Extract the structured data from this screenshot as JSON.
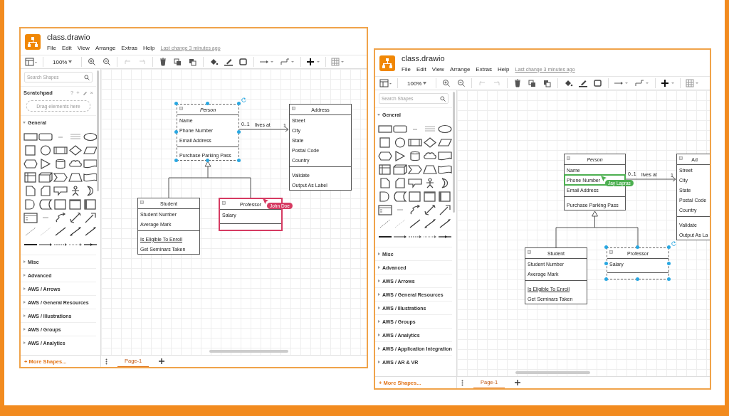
{
  "windows": [
    {
      "title": "class.drawio",
      "menu": [
        "File",
        "Edit",
        "View",
        "Arrange",
        "Extras",
        "Help"
      ],
      "last_change": "Last change 3 minutes ago",
      "toolbar": {
        "zoom": "100%",
        "undo": {
          "disabled": true
        },
        "redo": {
          "disabled": true
        }
      },
      "sidebar": {
        "search": {
          "placeholder": "Search Shapes"
        },
        "scratchpad": {
          "title": "Scratchpad",
          "tools": [
            "?",
            "+",
            "×"
          ],
          "hint": "Drag elements here"
        },
        "sections": [
          {
            "label": "General",
            "expanded": true
          },
          {
            "label": "Misc",
            "expanded": false
          },
          {
            "label": "Advanced",
            "expanded": false
          },
          {
            "label": "AWS / Arrows",
            "expanded": false
          },
          {
            "label": "AWS / General Resources",
            "expanded": false
          },
          {
            "label": "AWS / Illustrations",
            "expanded": false
          },
          {
            "label": "AWS / Groups",
            "expanded": false
          },
          {
            "label": "AWS / Analytics",
            "expanded": false
          }
        ],
        "more_shapes": "+ More Shapes..."
      },
      "diagram": {
        "classes": [
          {
            "name": "Person",
            "abstract": true,
            "selected": true,
            "attributes": [
              {
                "text": "Name"
              },
              {
                "text": "Phone Number"
              },
              {
                "text": "Email Address"
              }
            ],
            "methods": [
              {
                "text": "Purchase Parking Pass",
                "static": false
              }
            ]
          },
          {
            "name": "Address",
            "abstract": false,
            "selected": false,
            "attributes": [
              {
                "text": "Street"
              },
              {
                "text": "City"
              },
              {
                "text": "State"
              },
              {
                "text": "Postal Code"
              },
              {
                "text": "Country"
              }
            ],
            "methods": [
              {
                "text": "Validate",
                "static": false
              },
              {
                "text": "Output As Label",
                "static": false
              }
            ]
          },
          {
            "name": "Student",
            "abstract": false,
            "selected": false,
            "attributes": [
              {
                "text": "Student Number"
              },
              {
                "text": "Average Mark"
              }
            ],
            "methods": [
              {
                "text": "Is Eligible To Enroll",
                "static": true
              },
              {
                "text": "Get Seminars Taken",
                "static": false
              }
            ]
          },
          {
            "name": "Professor",
            "abstract": false,
            "selected": false,
            "attributes": [
              {
                "text": "Salary"
              }
            ],
            "collaborator": {
              "name": "John Doe",
              "color": "#d63b62"
            }
          }
        ],
        "association": {
          "label": "lives at",
          "source_multiplicity": "0..1",
          "target_multiplicity": "1"
        }
      },
      "pages": [
        {
          "label": "Page-1",
          "selected": true
        }
      ]
    },
    {
      "title": "class.drawio",
      "menu": [
        "File",
        "Edit",
        "View",
        "Arrange",
        "Extras",
        "Help"
      ],
      "last_change": "Last change 3 minutes ago",
      "toolbar": {
        "zoom": "100%",
        "undo": {
          "disabled": true
        },
        "redo": {
          "disabled": true
        }
      },
      "sidebar": {
        "search": {
          "placeholder": "Search Shapes"
        },
        "sections": [
          {
            "label": "General",
            "expanded": true
          },
          {
            "label": "Misc",
            "expanded": false
          },
          {
            "label": "Advanced",
            "expanded": false
          },
          {
            "label": "AWS / Arrows",
            "expanded": false
          },
          {
            "label": "AWS / General Resources",
            "expanded": false
          },
          {
            "label": "AWS / Illustrations",
            "expanded": false
          },
          {
            "label": "AWS / Groups",
            "expanded": false
          },
          {
            "label": "AWS / Analytics",
            "expanded": false
          },
          {
            "label": "AWS / Application Integration",
            "expanded": false
          },
          {
            "label": "AWS / AR & VR",
            "expanded": false
          }
        ],
        "more_shapes": "+ More Shapes..."
      },
      "diagram": {
        "classes": [
          {
            "name": "Person",
            "abstract": true,
            "selected": false,
            "attributes": [
              {
                "text": "Name"
              },
              {
                "text": "Phone Number",
                "collaborator": {
                  "name": "Jay Lapras",
                  "color": "#4caf50"
                }
              },
              {
                "text": "Email Address"
              }
            ],
            "methods": [
              {
                "text": "Purchase Parking Pass",
                "static": false
              }
            ]
          },
          {
            "name": "Ad",
            "abstract": false,
            "selected": false,
            "attributes": [
              {
                "text": "Street"
              },
              {
                "text": "City"
              },
              {
                "text": "State"
              },
              {
                "text": "Postal Code"
              },
              {
                "text": "Country"
              }
            ],
            "methods": [
              {
                "text": "Validate",
                "static": false
              },
              {
                "text": "Output As La",
                "static": false
              }
            ]
          },
          {
            "name": "Student",
            "abstract": false,
            "selected": false,
            "attributes": [
              {
                "text": "Student Number"
              },
              {
                "text": "Average Mark"
              }
            ],
            "methods": [
              {
                "text": "Is Eligible To Enroll",
                "static": true
              },
              {
                "text": "Get Seminars Taken",
                "static": false
              }
            ]
          },
          {
            "name": "Professor",
            "abstract": false,
            "selected": true,
            "attributes": [
              {
                "text": "Salary"
              }
            ]
          }
        ],
        "association": {
          "label": "lives at",
          "source_multiplicity": "0..1",
          "target_multiplicity": "1"
        }
      },
      "pages": [
        {
          "label": "Page-1",
          "selected": true
        }
      ]
    }
  ]
}
